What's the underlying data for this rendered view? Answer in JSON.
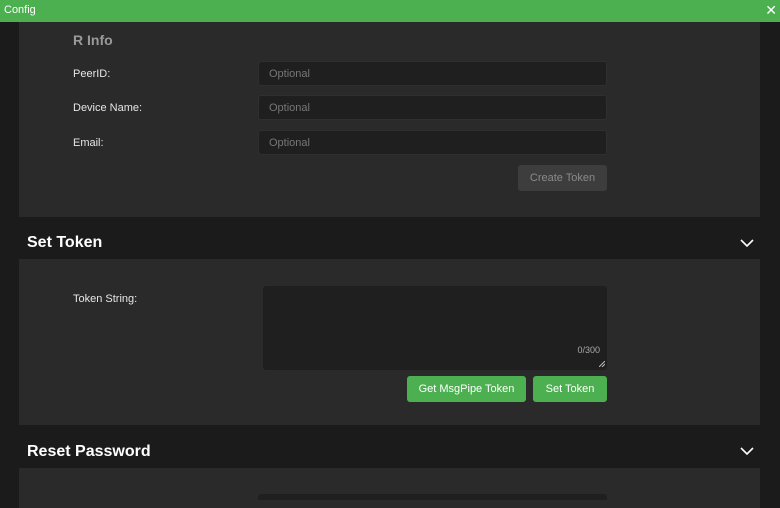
{
  "window": {
    "title": "Config",
    "close_glyph": "✕"
  },
  "info_section": {
    "title": "R Info",
    "fields": [
      {
        "label": "PeerID:",
        "value": "",
        "placeholder": "Optional"
      },
      {
        "label": "Device Name:",
        "value": "",
        "placeholder": "Optional"
      },
      {
        "label": "Email:",
        "value": "",
        "placeholder": "Optional"
      }
    ],
    "create_button": "Create Token"
  },
  "set_token_section": {
    "title": "Set Token",
    "token_label": "Token String:",
    "token_value": "",
    "counter": "0/300",
    "get_button": "Get MsgPipe Token",
    "set_button": "Set Token"
  },
  "reset_password_section": {
    "title": "Reset Password"
  },
  "icons": {
    "close": "close-icon",
    "chevron": "chevron-down-icon",
    "resize": "resize-grip-icon"
  },
  "colors": {
    "accent": "#4caf50",
    "background": "#1b1b1b",
    "panel": "#2a2a2a",
    "input": "#1f1f1f"
  }
}
